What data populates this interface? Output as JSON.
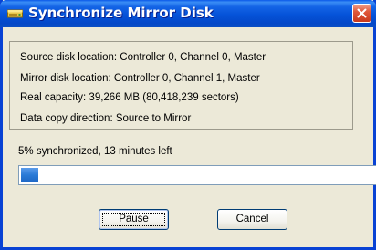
{
  "window": {
    "title": "Synchronize Mirror Disk",
    "icon": "disk-drive-icon",
    "close_icon": "close-icon",
    "titlebar_color": "#0552d8",
    "close_color": "#c8391c"
  },
  "info": {
    "source": "Source disk location: Controller 0, Channel 0, Master",
    "mirror": "Mirror disk location: Controller 0, Channel 1, Master",
    "capacity": "Real capacity: 39,266 MB (80,418,239 sectors)",
    "direction": "Data copy direction: Source to Mirror"
  },
  "progress": {
    "status": "5% synchronized, 13 minutes left",
    "fraction": 0.05,
    "fill_color": "#2a7ad6"
  },
  "buttons": {
    "pause": "Pause",
    "cancel": "Cancel"
  }
}
